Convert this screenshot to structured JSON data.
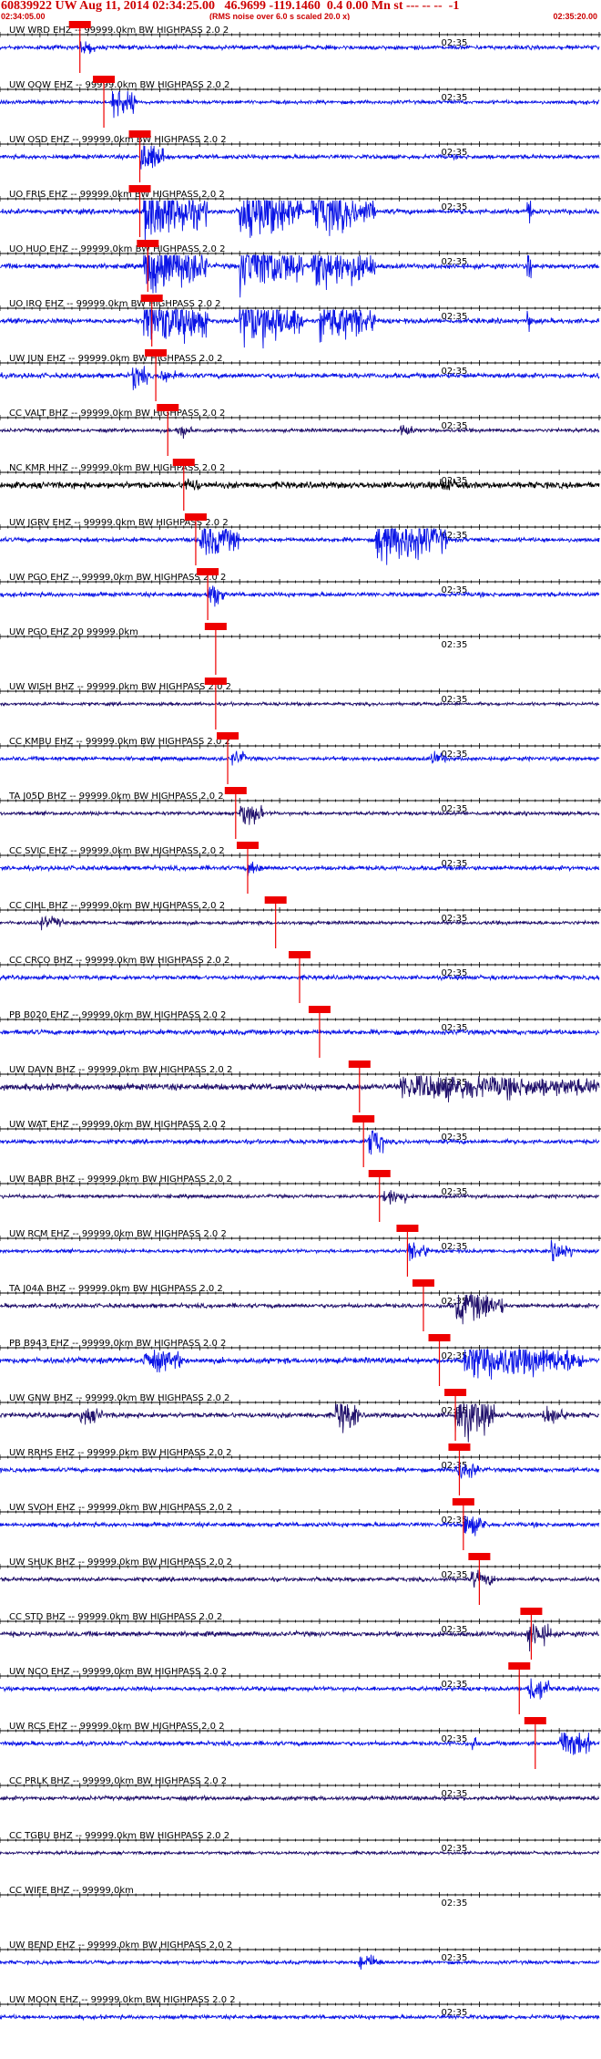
{
  "header": {
    "title": "60839922 UW Aug 11, 2014 02:34:25.00   46.9699 -119.1460  0.4 0.00 Mn st --- -- --  -1",
    "start_time": "02:34:05.00",
    "note": "(RMS noise over 6.0 s scaled 20.0 x)",
    "end_time": "02:35:20.00"
  },
  "chart_data": {
    "type": "line",
    "description_none": "",
    "x_start": "02:34:05.00",
    "x_end": "02:35:20.00",
    "x_range_s": [
      0,
      75
    ],
    "mid_tick_label": "02:35",
    "mid_tick_s": 55,
    "pick_label": "",
    "colors": {
      "blue": "#0a14e6",
      "navy": "#20106b",
      "black": "#000000",
      "pick": "#ee0000"
    },
    "traces": [
      {
        "label": "UW WRD EHZ -- 99999.0km BW  HIGHPASS  2.0  2",
        "pick_s": 10.0,
        "color": "blue",
        "amp": 0.3,
        "events": [
          [
            10.0,
            0.8,
            2
          ]
        ]
      },
      {
        "label": "UW OOW EHZ -- 99999.0km BW  HIGHPASS  2.0  2",
        "pick_s": 13.0,
        "color": "blue",
        "amp": 0.25,
        "events": [
          [
            14.0,
            2.5,
            3
          ]
        ]
      },
      {
        "label": "UW OSD EHZ -- 99999.0km BW  HIGHPASS  2.0  2",
        "pick_s": 17.5,
        "color": "blue",
        "amp": 0.3,
        "events": [
          [
            17.5,
            2.5,
            3
          ]
        ]
      },
      {
        "label": "UO FRIS EHZ -- 99999.0km BW  HIGHPASS  2.0  2",
        "pick_s": 17.5,
        "color": "blue",
        "amp": 0.35,
        "events": [
          [
            18,
            4,
            8
          ],
          [
            30,
            4,
            8
          ],
          [
            39,
            3,
            8
          ],
          [
            66,
            3,
            0.5
          ]
        ]
      },
      {
        "label": "UO HUO EHZ -- 99999.0km BW  HIGHPASS  2.0  2",
        "pick_s": 18.5,
        "color": "blue",
        "amp": 0.35,
        "events": [
          [
            18,
            4,
            8
          ],
          [
            30,
            4,
            8
          ],
          [
            39,
            3,
            8
          ],
          [
            66,
            3,
            0.5
          ]
        ]
      },
      {
        "label": "UO IRO EHZ -- 99999.0km BW  HIGHPASS  2.0  2",
        "pick_s": 19.0,
        "color": "blue",
        "amp": 0.35,
        "events": [
          [
            18,
            4,
            8
          ],
          [
            30,
            4,
            8
          ],
          [
            40,
            3,
            7
          ],
          [
            66,
            2,
            0.5
          ]
        ]
      },
      {
        "label": "UW JUN EHZ -- 99999.0km BW  HIGHPASS  2.0  2",
        "pick_s": 19.5,
        "color": "blue",
        "amp": 0.35,
        "events": [
          [
            16.5,
            1.8,
            2
          ],
          [
            20,
            1.0,
            2
          ]
        ]
      },
      {
        "label": "CC VALT BHZ -- 99999.0km BW  HIGHPASS  2.0  2",
        "pick_s": 21.0,
        "color": "navy",
        "amp": 0.25,
        "events": [
          [
            22,
            1.0,
            2
          ],
          [
            50,
            0.8,
            2
          ]
        ]
      },
      {
        "label": "NC KMR HHZ -- 99999.0km BW  HIGHPASS  2.0  2",
        "pick_s": 23.0,
        "color": "black",
        "amp": 0.45,
        "events": [
          [
            23,
            0.8,
            2
          ],
          [
            55,
            0.6,
            3
          ]
        ]
      },
      {
        "label": "UW JGRV EHZ -- 99999.0km BW  HIGHPASS  2.0  2",
        "pick_s": 24.5,
        "color": "blue",
        "amp": 0.3,
        "events": [
          [
            25,
            2.5,
            5
          ],
          [
            47,
            3.5,
            9
          ]
        ]
      },
      {
        "label": "UW PGO EHZ -- 99999.0km BW  HIGHPASS  2.0  2",
        "pick_s": 26.0,
        "color": "blue",
        "amp": 0.3,
        "events": [
          [
            26,
            2.0,
            2
          ]
        ]
      },
      {
        "label": "UW PGO EHZ 20 99999.0km",
        "pick_s": 27.0,
        "color": "blue",
        "amp": 0.0,
        "events": []
      },
      {
        "label": "UW WISH BHZ -- 99999.0km BW  HIGHPASS  2.0  2",
        "pick_s": 27.0,
        "color": "navy",
        "amp": 0.22,
        "events": []
      },
      {
        "label": "CC KMBU EHZ -- 99999.0km BW  HIGHPASS  2.0  2",
        "pick_s": 28.5,
        "color": "blue",
        "amp": 0.28,
        "events": [
          [
            29,
            1.0,
            2
          ],
          [
            54,
            0.8,
            2
          ]
        ]
      },
      {
        "label": "TA J05D BHZ -- 99999.0km BW  HIGHPASS  2.0  2",
        "pick_s": 29.5,
        "color": "navy",
        "amp": 0.25,
        "events": [
          [
            30,
            1.8,
            3
          ]
        ]
      },
      {
        "label": "CC SVIC EHZ -- 99999.0km BW  HIGHPASS  2.0  2",
        "pick_s": 31.0,
        "color": "blue",
        "amp": 0.32,
        "events": [
          [
            31,
            0.8,
            2
          ]
        ]
      },
      {
        "label": "CC CIHL BHZ -- 99999.0km BW  HIGHPASS  2.0  2",
        "pick_s": 34.5,
        "color": "navy",
        "amp": 0.25,
        "events": [
          [
            5,
            0.8,
            3
          ]
        ]
      },
      {
        "label": "CC CRCO BHZ -- 99999.0km BW  HIGHPASS  2.0  2",
        "pick_s": 37.5,
        "color": "blue",
        "amp": 0.3,
        "events": []
      },
      {
        "label": "PB B020 EHZ -- 99999.0km BW  HIGHPASS  2.0  2",
        "pick_s": 40.0,
        "color": "blue",
        "amp": 0.35,
        "events": []
      },
      {
        "label": "UW DAVN BHZ -- 99999.0km BW  HIGHPASS  2.0  2",
        "pick_s": 45.0,
        "color": "navy",
        "amp": 0.45,
        "events": [
          [
            50,
            1.6,
            25
          ]
        ]
      },
      {
        "label": "UW WAT EHZ -- 99999.0km BW  HIGHPASS  2.0  2",
        "pick_s": 45.5,
        "color": "blue",
        "amp": 0.3,
        "events": [
          [
            46,
            2.5,
            2
          ]
        ]
      },
      {
        "label": "UW BABR BHZ -- 99999.0km BW  HIGHPASS  2.0  2",
        "pick_s": 47.5,
        "color": "navy",
        "amp": 0.25,
        "events": [
          [
            48,
            1.2,
            3
          ]
        ]
      },
      {
        "label": "UW RCM EHZ -- 99999.0km BW  HIGHPASS  2.0  2",
        "pick_s": 51.0,
        "color": "blue",
        "amp": 0.25,
        "events": [
          [
            51,
            1.2,
            3
          ],
          [
            69,
            1.2,
            3
          ]
        ]
      },
      {
        "label": "TA J04A BHZ -- 99999.0km BW  HIGHPASS  2.0  2",
        "pick_s": 53.0,
        "color": "navy",
        "amp": 0.3,
        "events": [
          [
            57,
            2.5,
            6
          ]
        ]
      },
      {
        "label": "PB B943 EHZ -- 99999.0km BW  HIGHPASS  2.0  2",
        "pick_s": 55.0,
        "color": "blue",
        "amp": 0.4,
        "events": [
          [
            18,
            1.5,
            5
          ],
          [
            58,
            2.5,
            15
          ]
        ]
      },
      {
        "label": "UW GNW BHZ -- 99999.0km BW  HIGHPASS  2.0  2",
        "pick_s": 57.0,
        "color": "navy",
        "amp": 0.35,
        "events": [
          [
            10,
            1.0,
            3
          ],
          [
            42,
            2.5,
            3
          ],
          [
            57,
            3.5,
            5
          ],
          [
            68,
            1.2,
            3
          ]
        ]
      },
      {
        "label": "UW RRHS EHZ -- 99999.0km BW  HIGHPASS  2.0  2",
        "pick_s": 57.5,
        "color": "blue",
        "amp": 0.3,
        "events": [
          [
            57,
            1.2,
            3
          ]
        ]
      },
      {
        "label": "UW SVOH EHZ -- 99999.0km BW  HIGHPASS  2.0  2",
        "pick_s": 58.0,
        "color": "blue",
        "amp": 0.3,
        "events": [
          [
            58,
            1.5,
            3
          ]
        ]
      },
      {
        "label": "UW SHUK BHZ -- 99999.0km BW  HIGHPASS  2.0  2",
        "pick_s": 60.0,
        "color": "navy",
        "amp": 0.28,
        "events": [
          [
            59,
            1.0,
            3
          ]
        ]
      },
      {
        "label": "CC STD BHZ -- 99999.0km BW  HIGHPASS  2.0  2",
        "pick_s": 66.5,
        "color": "navy",
        "amp": 0.35,
        "events": [
          [
            66,
            2.0,
            3
          ]
        ]
      },
      {
        "label": "UW NCO EHZ -- 99999.0km BW  HIGHPASS  2.0  2",
        "pick_s": 65.0,
        "color": "blue",
        "amp": 0.3,
        "events": [
          [
            66,
            2.0,
            3
          ]
        ]
      },
      {
        "label": "UW RCS EHZ -- 99999.0km BW  HIGHPASS  2.0  2",
        "pick_s": 67.0,
        "color": "blue",
        "amp": 0.3,
        "events": [
          [
            59,
            1.5,
            0.6
          ],
          [
            70,
            2.5,
            4
          ]
        ]
      },
      {
        "label": "CC PRLK BHZ -- 99999.0km BW  HIGHPASS  2.0  2",
        "pick_s": null,
        "color": "navy",
        "amp": 0.3,
        "events": []
      },
      {
        "label": "CC TGBU BHZ -- 99999.0km BW  HIGHPASS  2.0  2",
        "pick_s": null,
        "color": "navy",
        "amp": 0.22,
        "events": []
      },
      {
        "label": "CC WIFE BHZ -- 99999.0km",
        "pick_s": null,
        "color": "blue",
        "amp": 0.0,
        "events": []
      },
      {
        "label": "UW BEND EHZ -- 99999.0km BW  HIGHPASS  2.0  2",
        "pick_s": null,
        "color": "blue",
        "amp": 0.25,
        "events": [
          [
            45,
            1.0,
            3
          ]
        ]
      },
      {
        "label": "UW MOON EHZ -- 99999.0km BW  HIGHPASS  2.0  2",
        "pick_s": null,
        "color": "blue",
        "amp": 0.28,
        "events": []
      }
    ]
  }
}
